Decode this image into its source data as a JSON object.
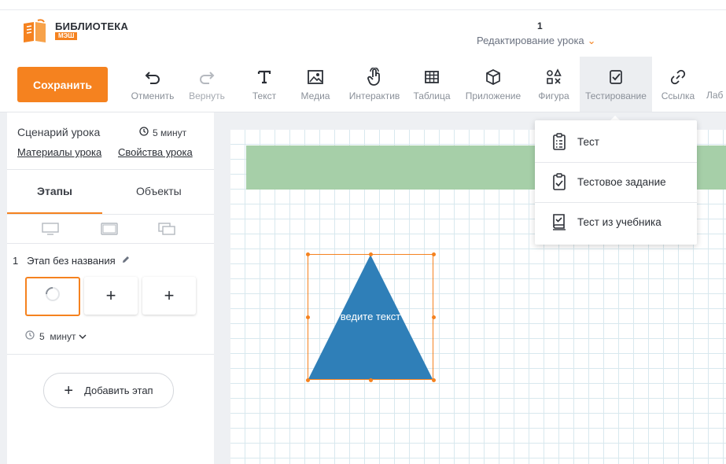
{
  "header": {
    "logo_text": "БИБЛИОТЕКА",
    "logo_badge": "МЭШ",
    "lesson_number": "1",
    "lesson_title": "Редактирование урока",
    "lesson_chevron": "˅"
  },
  "toolbar": {
    "save_label": "Сохранить",
    "tools": [
      {
        "label": "Отменить",
        "icon": "undo-icon"
      },
      {
        "label": "Вернуть",
        "icon": "redo-icon"
      },
      {
        "label": "Текст",
        "icon": "text-icon"
      },
      {
        "label": "Медиа",
        "icon": "media-icon"
      },
      {
        "label": "Интерактив",
        "icon": "pointer-hand-icon"
      },
      {
        "label": "Таблица",
        "icon": "table-icon"
      },
      {
        "label": "Приложение",
        "icon": "cube-icon"
      },
      {
        "label": "Фигура",
        "icon": "shapes-icon"
      },
      {
        "label": "Тестирование",
        "icon": "check-square-icon"
      },
      {
        "label": "Ссылка",
        "icon": "link-icon"
      },
      {
        "label": "Лаб",
        "icon": "lab-icon"
      }
    ]
  },
  "sidebar": {
    "scenario_title": "Сценарий урока",
    "scenario_time": "5 минут",
    "materials_link": "Материалы урока",
    "properties_link": "Свойства урока",
    "tabs": [
      "Этапы",
      "Объекты"
    ],
    "stage_number": "1",
    "stage_name": "Этап без названия",
    "add_slide_symbol": "+",
    "stage_time_value": "5",
    "stage_time_unit": "минут",
    "add_stage_label": "Добавить этап"
  },
  "canvas": {
    "shape_text": "ведите текст"
  },
  "testing_menu": {
    "items": [
      {
        "label": "Тест",
        "icon": "clipboard-list-icon"
      },
      {
        "label": "Тестовое задание",
        "icon": "clipboard-check-icon"
      },
      {
        "label": "Тест из учебника",
        "icon": "book-check-icon"
      }
    ]
  },
  "colors": {
    "accent": "#f5821f",
    "shape_fill": "#2f7fb8",
    "band": "#a6cfa8"
  }
}
